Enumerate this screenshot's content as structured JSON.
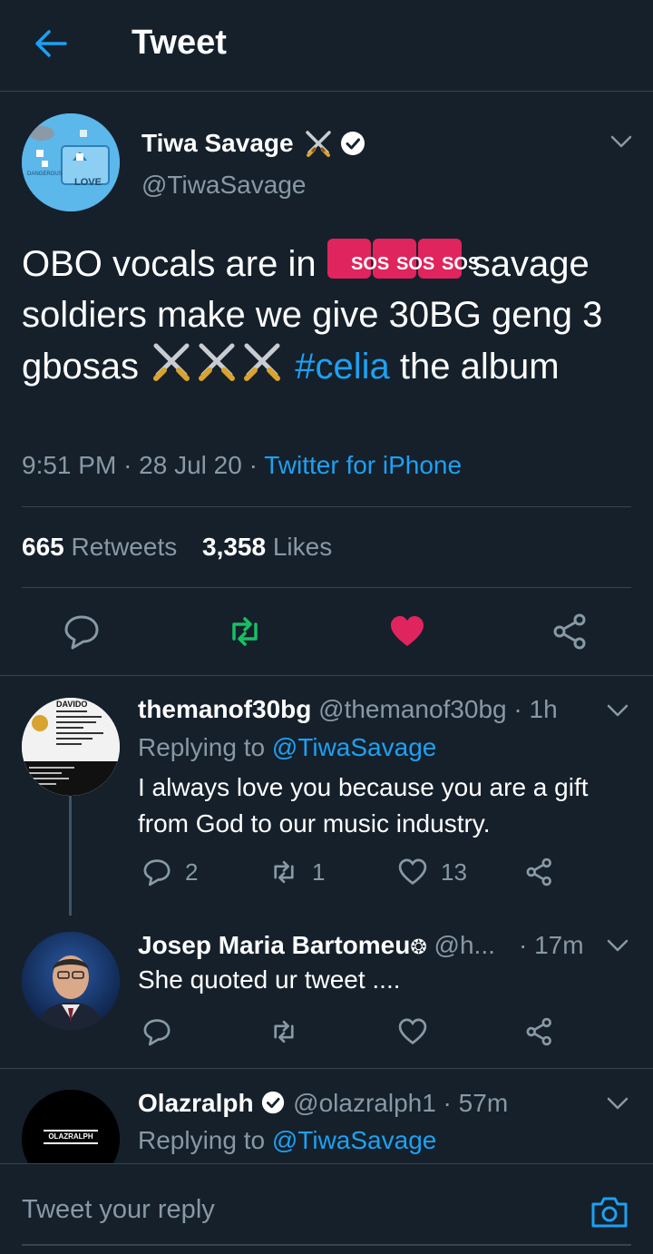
{
  "header": {
    "title": "Tweet"
  },
  "main_tweet": {
    "author_name": "Tiwa Savage",
    "handle": "@TiwaSavage",
    "text_part1": "OBO vocals are in ",
    "sos_emoji": "SOS",
    "text_part2": " savage soldiers make we give 30BG geng 3 gbosas ",
    "hashtag": "#celia",
    "text_part3": " the album",
    "time": "9:51 PM",
    "date": "28 Jul 20",
    "source": "Twitter for iPhone",
    "retweet_count": "665",
    "retweet_label": "Retweets",
    "like_count": "3,358",
    "like_label": "Likes",
    "avatar_text_top": "DANGEROUS",
    "avatar_text_bottom": "LOVE"
  },
  "replies": [
    {
      "name": "themanof30bg",
      "handle": "@themanof30bg",
      "time": "1h",
      "replying_prefix": "Replying to",
      "replying_handle": "@TiwaSavage",
      "text": "I always love you because you are a gift from God to our music industry.",
      "reply_count": "2",
      "retweet_count": "1",
      "like_count": "13",
      "avatar_heading": "DAVIDO"
    },
    {
      "name": "Josep Maria Bartomeu",
      "name_badge": "❂",
      "handle": "@h...",
      "time": "17m",
      "text": "She quoted ur tweet ...."
    },
    {
      "name": "Olazralph",
      "handle": "@olazralph1",
      "time": "57m",
      "replying_prefix": "Replying to",
      "replying_handle": "@TiwaSavage",
      "avatar_text": "OLAZRALPH"
    }
  ],
  "compose": {
    "placeholder": "Tweet your reply"
  },
  "colors": {
    "background": "#15202b",
    "accent": "#1da1f2",
    "muted": "#8899a6",
    "retweet_green": "#17bf63",
    "like_red": "#e0245e",
    "divider": "#38444d"
  }
}
